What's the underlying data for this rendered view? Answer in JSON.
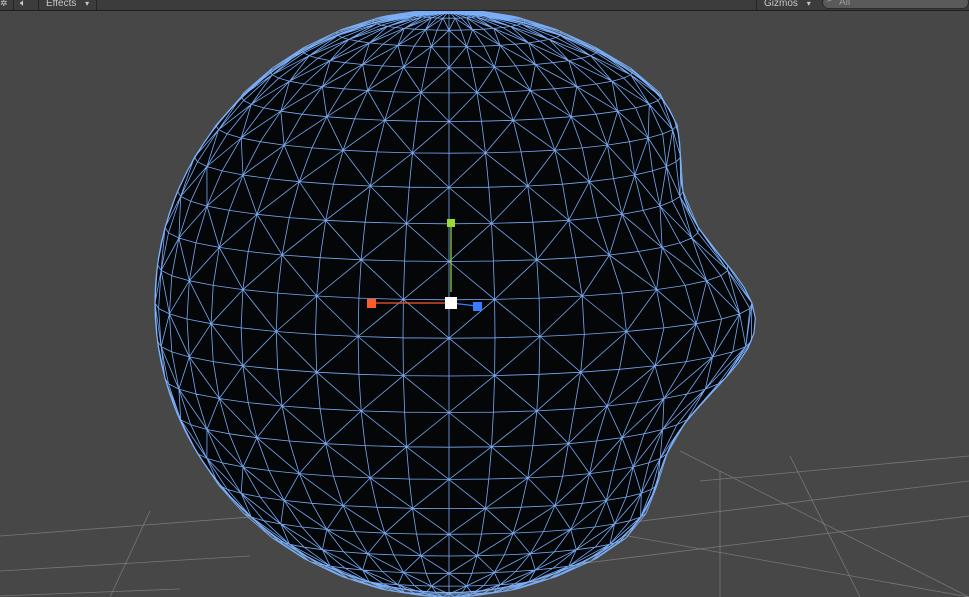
{
  "toolbar": {
    "effects_label": "Effects",
    "gizmos_label": "Gizmos",
    "search_placeholder": "All",
    "dropdown_glyph": "▾"
  },
  "scene": {
    "background_color": "#474747",
    "wireframe_color": "#7db3ff",
    "mesh_fill_color": "#050608",
    "grid_color": "#8a8a8a",
    "gizmo": {
      "x_color": "#ff5a2a",
      "y_color": "#9cdc32",
      "z_color": "#3a7cff",
      "center_color": "#ffffff"
    }
  }
}
